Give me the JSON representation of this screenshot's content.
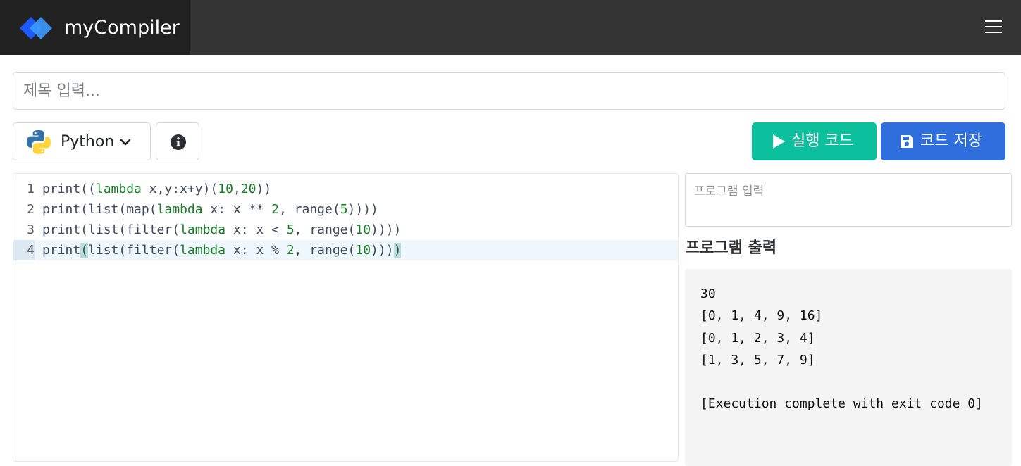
{
  "navbar": {
    "brand_name": "myCompiler",
    "logo_icon": "diamond-logo-icon",
    "menu_icon": "hamburger-menu-icon",
    "logo_colors": [
      "#1e5bff",
      "#3d9bff"
    ]
  },
  "title_input": {
    "placeholder": "제목 입력...",
    "value": ""
  },
  "toolbar": {
    "language": "Python",
    "language_icon": "python-logo-icon",
    "info_icon": "info-circle-icon",
    "run_label": "실행 코드",
    "run_icon": "play-icon",
    "save_label": "코드 저장",
    "save_icon": "floppy-disk-icon"
  },
  "editor": {
    "lines": [
      {
        "number": "1",
        "text": "print((lambda x,y:x+y)(10,20))"
      },
      {
        "number": "2",
        "text": "print(list(map(lambda x: x ** 2, range(5))))"
      },
      {
        "number": "3",
        "text": "print(list(filter(lambda x: x < 5, range(10))))"
      },
      {
        "number": "4",
        "text": "print(list(filter(lambda x: x % 2, range(10))))"
      }
    ],
    "active_line": 4
  },
  "program_input": {
    "placeholder": "프로그램 입력",
    "value": ""
  },
  "output": {
    "heading": "프로그램 출력",
    "lines": [
      "30",
      "[0, 1, 4, 9, 16]",
      "[0, 1, 2, 3, 4]",
      "[1, 3, 5, 7, 9]",
      "",
      "[Execution complete with exit code 0]"
    ]
  },
  "colors": {
    "navbar_bg": "#343434",
    "brand_bg": "#212121",
    "run_button": "#0cbf9d",
    "save_button": "#2e6fdd",
    "keyword": "#1b7c2a",
    "active_line_bg": "#eef7fc"
  }
}
